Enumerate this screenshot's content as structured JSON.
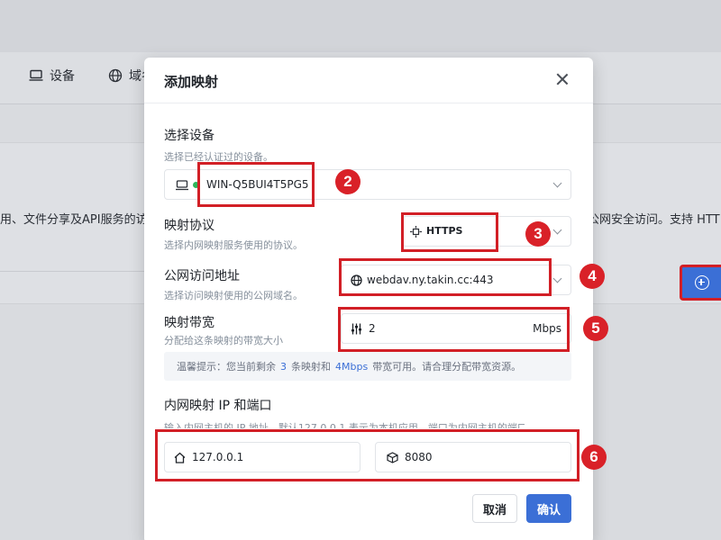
{
  "background": {
    "tabs": [
      {
        "icon": "monitor-icon",
        "label": "设备"
      },
      {
        "icon": "globe-icon",
        "label": "域名"
      }
    ],
    "description_left": "用、文件分享及API服务的访",
    "description_right": "公网安全访问。支持 HTT"
  },
  "dialog": {
    "title": "添加映射",
    "device": {
      "label": "选择设备",
      "hint": "选择已经认证过的设备。",
      "value": "WIN-Q5BUI4T5PG5",
      "status_color": "#2fb55a"
    },
    "protocol": {
      "label": "映射协议",
      "hint": "选择内网映射服务使用的协议。",
      "value": "HTTPS"
    },
    "public_address": {
      "label": "公网访问地址",
      "hint": "选择访问映射使用的公网域名。",
      "value": "webdav.ny.takin.cc:443"
    },
    "bandwidth": {
      "label": "映射带宽",
      "hint": "分配给这条映射的带宽大小",
      "value": "2",
      "unit": "Mbps"
    },
    "tip": {
      "prefix": "温馨提示：您当前剩余",
      "mappings_left": "3",
      "middle": "条映射和",
      "bandwidth_left": "4Mbps",
      "suffix": "带宽可用。请合理分配带宽资源。"
    },
    "internal": {
      "label": "内网映射 IP 和端口",
      "hint": "输入内网主机的 IP 地址，默认127.0.0.1 表示为本机应用，端口为内网主机的端口",
      "ip": "127.0.0.1",
      "port": "8080"
    },
    "buttons": {
      "cancel": "取消",
      "confirm": "确认"
    }
  },
  "annotations": [
    "2",
    "3",
    "4",
    "5",
    "6"
  ],
  "colors": {
    "accent": "#3b6fd6",
    "highlight_red": "#d21f26"
  }
}
